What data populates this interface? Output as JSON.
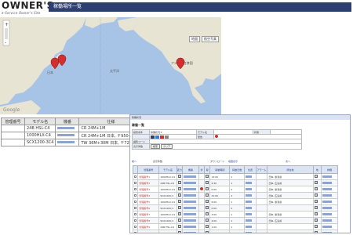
{
  "header": {
    "logo_main": "OWNER'S",
    "logo_sub": "e-Service Owner's Site",
    "page_title": "稼働場所一覧"
  },
  "map": {
    "btn_map": "地図",
    "btn_satellite": "航空写真",
    "labels": {
      "pacific": "太平洋",
      "na": "アメリカ合衆国",
      "japan": "日本",
      "google": "Google"
    },
    "markers": [
      "A",
      "B",
      "C"
    ]
  },
  "machines": {
    "headers": [
      "管理番号",
      "モデル名",
      "機番",
      "仕様"
    ],
    "rows": [
      [
        "",
        "24B HSL-C4",
        "",
        "CR 24M+1M"
      ],
      [
        "",
        "1000HLX-C4",
        "",
        "CR 24M+1M 日本, 〒950-312"
      ],
      [
        "",
        "SCX1200-3C4",
        "",
        "TW 36M+30M 日本, 〒729-041"
      ]
    ]
  },
  "panel": {
    "topbar": "稼働状況",
    "heading": "稼働一覧",
    "filter": {
      "label1": "検索条件",
      "select_value": "稼働状況",
      "model_label": "モデル名",
      "status_label": "状態",
      "warning_label": "警告",
      "code_label": "識別コード",
      "search_button": "検索",
      "clear_button": "クリア",
      "note": "表示件数"
    },
    "toolbar": {
      "prev": "前へ",
      "count": "表示件数",
      "download": "ダウンロード",
      "map_link": "地図表示",
      "next": "次へ"
    },
    "headers": [
      "",
      "管理番号",
      "モデル名",
      "区分",
      "機番",
      "状",
      "稼",
      "稼動時間",
      "稼動日数",
      "位置",
      "アラーム",
      "所在地",
      "地",
      "詳細"
    ],
    "rows": [
      [
        "管理番号1",
        "1000HLX-C4",
        "",
        "",
        "",
        "",
        "",
        "13:00",
        "1",
        "",
        "",
        "日本, 新潟県",
        "",
        ""
      ],
      [
        "管理番号2",
        "24B HSL-C4",
        "",
        "",
        "",
        "",
        "",
        "9:30",
        "1",
        "",
        "",
        "日本, 広島県",
        "",
        ""
      ],
      [
        "管理番号3",
        "1000HLX-C4",
        "",
        "",
        "",
        "",
        "",
        "0:00",
        "0",
        "",
        "",
        "日本, 新潟県",
        "",
        ""
      ],
      [
        "管理番号4",
        "SCX1200-3",
        "",
        "",
        "",
        "",
        "",
        "21:00",
        "2",
        "",
        "",
        "日本, 広島県",
        "",
        ""
      ],
      [
        "管理番号5",
        "1000HLX-C4",
        "",
        "",
        "",
        "",
        "",
        "6:00",
        "1",
        "",
        "",
        "日本, 新潟県",
        "",
        ""
      ],
      [
        "管理番号6",
        "SCX1200-3",
        "",
        "",
        "",
        "",
        "",
        "0:00",
        "0",
        "",
        "",
        "",
        "",
        ""
      ],
      [
        "管理番号7",
        "1000HLX-C4",
        "",
        "",
        "",
        "",
        "",
        "3:00",
        "1",
        "",
        "",
        "日本, 新潟県",
        "",
        ""
      ],
      [
        "管理番号8",
        "SCX1200-3",
        "",
        "",
        "",
        "",
        "",
        "4:00",
        "1",
        "",
        "",
        "日本, 広島県",
        "",
        ""
      ],
      [
        "管理番号9",
        "24B HSL-C4",
        "",
        "",
        "",
        "",
        "",
        "1:00",
        "1",
        "",
        "",
        "",
        "",
        ""
      ],
      [
        "SCX1200-3",
        "",
        "",
        "",
        "",
        "",
        "",
        "0:00",
        "0",
        "",
        "",
        "",
        "",
        ""
      ]
    ]
  },
  "colors": {
    "title_bar": "#2d3f6e",
    "ocean": "#a7c4e6",
    "land": "#e8e4d4",
    "marker": "#d32f2f"
  }
}
